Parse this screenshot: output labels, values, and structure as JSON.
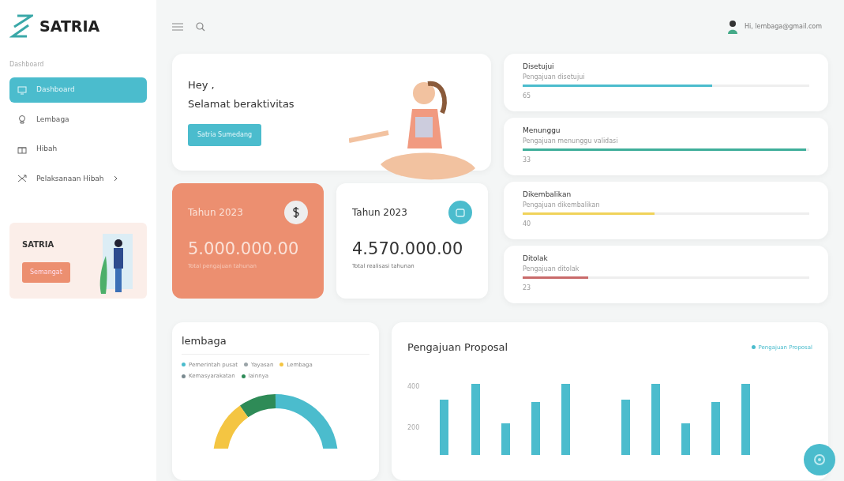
{
  "brand": "SATRIA",
  "sidebar": {
    "heading": "Dashboard",
    "items": [
      {
        "label": "Dashboard",
        "selected": true,
        "submenu": false
      },
      {
        "label": "Lembaga",
        "selected": false,
        "submenu": false
      },
      {
        "label": "Hibah",
        "selected": false,
        "submenu": false
      },
      {
        "label": "Pelaksanaan Hibah",
        "selected": false,
        "submenu": true
      }
    ],
    "promo": {
      "title": "SATRIA",
      "button": "Semangat"
    }
  },
  "topbar": {
    "user": "Hi, lembaga@gmail.com"
  },
  "welcome": {
    "greeting": "Hey ,",
    "message": "Selamat beraktivitas",
    "button": "Satria Sumedang"
  },
  "stats": [
    {
      "kind": "accent",
      "title": "Tahun 2023",
      "value": "5.000.000.00",
      "caption": "Total pengajuan tahunan"
    },
    {
      "kind": "plain",
      "title": "Tahun 2023",
      "value": "4.570.000.00",
      "caption": "Total realisasi tahunan"
    }
  ],
  "statuses": [
    {
      "title": "Disetujui",
      "subtitle": "Pengajuan disetujui",
      "count": "65",
      "level": 0.66,
      "color": "#4bbccd"
    },
    {
      "title": "Menunggu",
      "subtitle": "Pengajuan menunggu validasi",
      "count": "33",
      "level": 0.99,
      "color": "#3fae9a"
    },
    {
      "title": "Dikembalikan",
      "subtitle": "Pengajuan dikembalikan",
      "count": "40",
      "level": 0.46,
      "color": "#f0d35a"
    },
    {
      "title": "Ditolak",
      "subtitle": "Pengajuan ditolak",
      "count": "23",
      "level": 0.23,
      "color": "#c96a6a"
    }
  ],
  "lembaga": {
    "title": "lembaga",
    "legend": [
      {
        "label": "Pemerintah pusat",
        "color": "#4bbccd"
      },
      {
        "label": "Yayasan",
        "color": "#9aa4a8"
      },
      {
        "label": "Lembaga",
        "color": "#f4c542"
      },
      {
        "label": "Kemasyarakatan",
        "color": "#7a8a90"
      },
      {
        "label": "lainnya",
        "color": "#2e8b57"
      }
    ]
  },
  "proposal": {
    "title": "Pengajuan Proposal",
    "legend": "Pengajuan Proposal",
    "y_labels": [
      "400",
      "200"
    ]
  }
}
